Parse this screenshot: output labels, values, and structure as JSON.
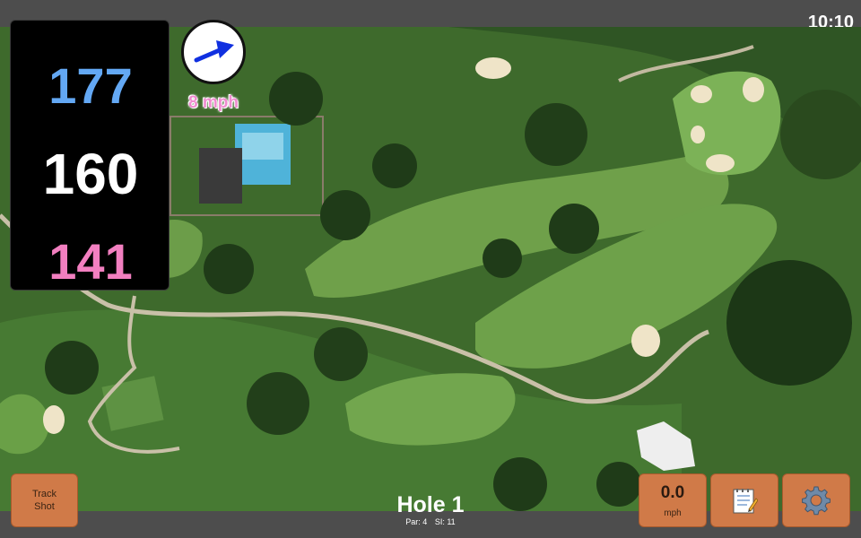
{
  "status": {
    "time": "10:10"
  },
  "distances": {
    "back": "177",
    "middle": "160",
    "front": "141"
  },
  "wind": {
    "speed_label": "8 mph",
    "direction_icon": "arrow-right-icon"
  },
  "hole": {
    "title": "Hole 1",
    "par_label": "Par: 4",
    "si_label": "SI: 11"
  },
  "buttons": {
    "track_shot_line1": "Track",
    "track_shot_line2": "Shot",
    "wind_value": "0.0",
    "wind_unit": "mph",
    "notes_icon": "notepad-icon",
    "settings_icon": "gear-icon"
  },
  "colors": {
    "back_distance": "#63a8f4",
    "middle_distance": "#ffffff",
    "front_distance": "#f27fc0",
    "button_bg": "#d07a48"
  }
}
